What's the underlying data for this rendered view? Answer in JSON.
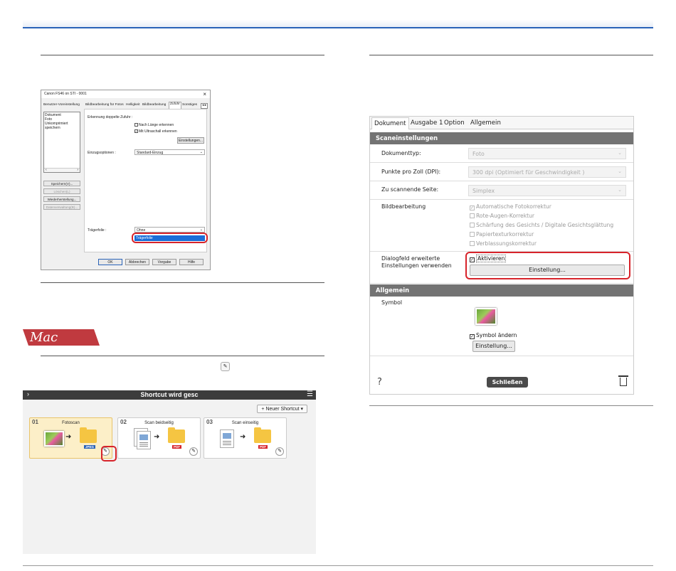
{
  "win_dialog": {
    "title": "Canon FS46 on STI - 0001",
    "close_glyph": "×",
    "tabs": [
      "Benutzer-Voreinstellung",
      "Bildbearbeitung für Fotos",
      "Helligkeit",
      "Bildbearbeitung",
      "Zufuhr",
      "Sonstiges",
      "◂ ▸"
    ],
    "presets": [
      "Dokument",
      "Foto",
      "Unkomprimiert speichern"
    ],
    "list_nav": [
      "‹",
      "›"
    ],
    "side_buttons": [
      "Speichern(V)...",
      "Löschen(L)",
      "Wiederherstellung...",
      "Datenverwaltung(B)..."
    ],
    "double_feed_label": "Erkennung doppelte Zufuhr :",
    "check_length": "Nach Länge erkennen",
    "check_length_mark": "",
    "check_ultrasonic": "Mit Ultraschall erkennen",
    "check_ultrasonic_mark": "✓",
    "settings_btn": "Einstellungen...",
    "feed_options_label": "Einzugsoptionen :",
    "feed_options_value": "Standard-Einzug",
    "carrier_label": "Trägerfolie :",
    "carrier_value": "Ohne",
    "carrier_dropdown_selected": "Trägerfolie",
    "buttons": {
      "ok": "OK",
      "cancel": "Abbrechen",
      "defaults": "Vorgabe",
      "help": "Hilfe"
    }
  },
  "mac": {
    "badge": "Mac",
    "toolbar": {
      "title": "Shortcut wird gesc",
      "chevron": "›",
      "menu": "☰",
      "new_shortcut": "+ Neuer Shortcut ▾"
    },
    "cards": [
      {
        "num": "01",
        "name": "Fotoscan",
        "format": "JPEG"
      },
      {
        "num": "02",
        "name": "Scan beidseitig",
        "format": "PDF"
      },
      {
        "num": "03",
        "name": "Scan einseitig",
        "format": "PDF"
      }
    ],
    "arrow": "➜",
    "edit_icon": "✎"
  },
  "dlg": {
    "tabs": [
      "Dokument",
      "Ausgabe 1",
      "Option",
      "Allgemein"
    ],
    "scan_settings_header": "Scaneinstellungen",
    "rows": [
      {
        "label": "Dokumenttyp:",
        "value": "Foto"
      },
      {
        "label": "Punkte pro Zoll (DPI):",
        "value": "300 dpi (Optimiert für Geschwindigkeit )"
      },
      {
        "label": "Zu scannende Seite:",
        "value": "Simplex"
      }
    ],
    "select_arrow": "⌄",
    "image_label": "Bildbearbeitung",
    "image_opts": [
      {
        "text": "Automatische Fotokorrektur",
        "mark": "✓"
      },
      {
        "text": "Rote-Augen-Korrektur",
        "mark": ""
      },
      {
        "text": "Schärfung des Gesichts / Digitale Gesichtsglättung",
        "mark": ""
      },
      {
        "text": "Papiertexturkorrektur",
        "mark": ""
      },
      {
        "text": "Verblassungskorrektur",
        "mark": ""
      }
    ],
    "advanced_label": "Dialogfeld erweiterte Einstellungen verwenden",
    "activate": "Aktivieren",
    "activate_mark": "✓",
    "setting_btn": "Einstellung...",
    "general_header": "Allgemein",
    "symbol_label": "Symbol",
    "change_symbol": "Symbol ändern",
    "change_symbol_mark": "✓",
    "symbol_setting_btn": "Einstellung...",
    "help": "?",
    "close": "Schließen"
  }
}
